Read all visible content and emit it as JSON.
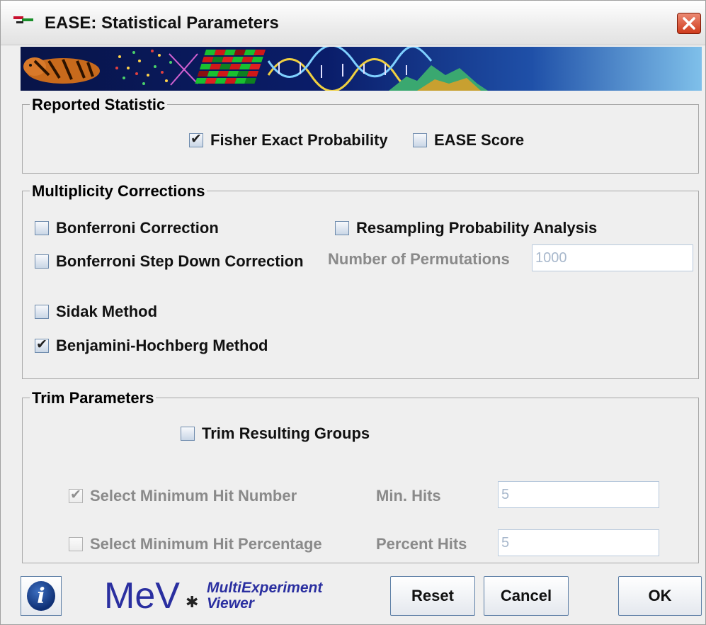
{
  "window": {
    "title": "EASE: Statistical Parameters"
  },
  "reported_statistic": {
    "title": "Reported Statistic",
    "fisher": {
      "label": "Fisher Exact Probability",
      "checked": true
    },
    "ease": {
      "label": "EASE Score",
      "checked": false
    }
  },
  "multiplicity": {
    "title": "Multiplicity Corrections",
    "bonferroni": {
      "label": "Bonferroni Correction",
      "checked": false
    },
    "bonferroni_step": {
      "label": "Bonferroni Step Down Correction",
      "checked": false
    },
    "sidak": {
      "label": "Sidak Method",
      "checked": false
    },
    "benjamini": {
      "label": "Benjamini-Hochberg Method",
      "checked": true
    },
    "resampling": {
      "label": "Resampling Probability Analysis",
      "checked": false
    },
    "permutations_label": "Number of Permutations",
    "permutations_value": "1000"
  },
  "trim": {
    "title": "Trim Parameters",
    "trim_groups": {
      "label": "Trim Resulting Groups",
      "checked": false
    },
    "min_hit_number": {
      "label": "Select Minimum Hit Number",
      "checked": true
    },
    "min_hit_percentage": {
      "label": "Select Minimum Hit Percentage",
      "checked": false
    },
    "min_hits_label": "Min. Hits",
    "min_hits_value": "5",
    "percent_hits_label": "Percent Hits",
    "percent_hits_value": "5"
  },
  "footer": {
    "logo_main": "MeV",
    "logo_line1": "MultiExperiment",
    "logo_line2": "Viewer",
    "reset_label": "Reset",
    "cancel_label": "Cancel",
    "ok_label": "OK"
  }
}
